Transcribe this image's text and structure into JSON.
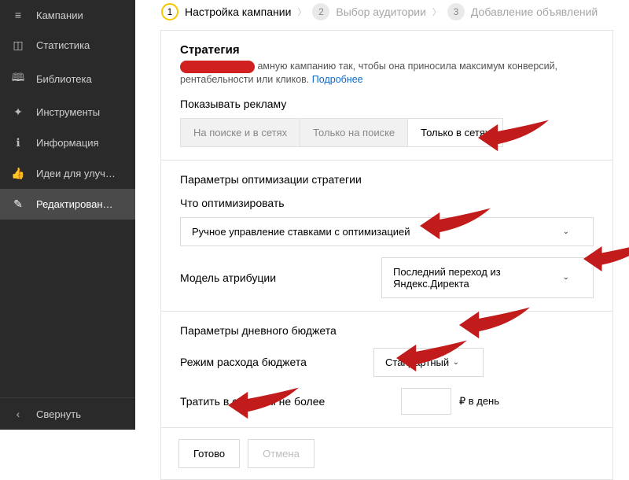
{
  "sidebar": {
    "items": [
      {
        "label": "Кампании",
        "icon": "≡"
      },
      {
        "label": "Статистика",
        "icon": "◫"
      },
      {
        "label": "Библиотека",
        "icon": "🕮"
      },
      {
        "label": "Инструменты",
        "icon": "✦"
      },
      {
        "label": "Информация",
        "icon": "ℹ"
      },
      {
        "label": "Идеи для улуч…",
        "icon": "👍"
      },
      {
        "label": "Редактирован…",
        "icon": "✎"
      }
    ],
    "collapse": {
      "label": "Свернуть",
      "icon": "‹"
    }
  },
  "stepper": {
    "steps": [
      {
        "num": "1",
        "label": "Настройка кампании"
      },
      {
        "num": "2",
        "label": "Выбор аудитории"
      },
      {
        "num": "3",
        "label": "Добавление объявлений"
      }
    ]
  },
  "strategy": {
    "title": "Стратегия",
    "desc1": "амную кампанию так, чтобы она приносила максимум конверсий, рентабельности или кликов.",
    "more": "Подробнее",
    "show_ads_label": "Показывать рекламу",
    "segments": [
      "На поиске и в сетях",
      "Только на поиске",
      "Только в сетях"
    ]
  },
  "optim": {
    "title": "Параметры оптимизации стратегии",
    "what_label": "Что оптимизировать",
    "what_value": "Ручное управление ставками с оптимизацией",
    "attr_label": "Модель атрибуции",
    "attr_value": "Последний переход из Яндекс.Директа"
  },
  "budget": {
    "title": "Параметры дневного бюджета",
    "mode_label": "Режим расхода бюджета",
    "mode_value": "Стандартный",
    "spend_label": "Тратить в среднем не более",
    "spend_value": "",
    "spend_hint": "₽ в день"
  },
  "footer": {
    "done": "Готово",
    "cancel": "Отмена"
  }
}
